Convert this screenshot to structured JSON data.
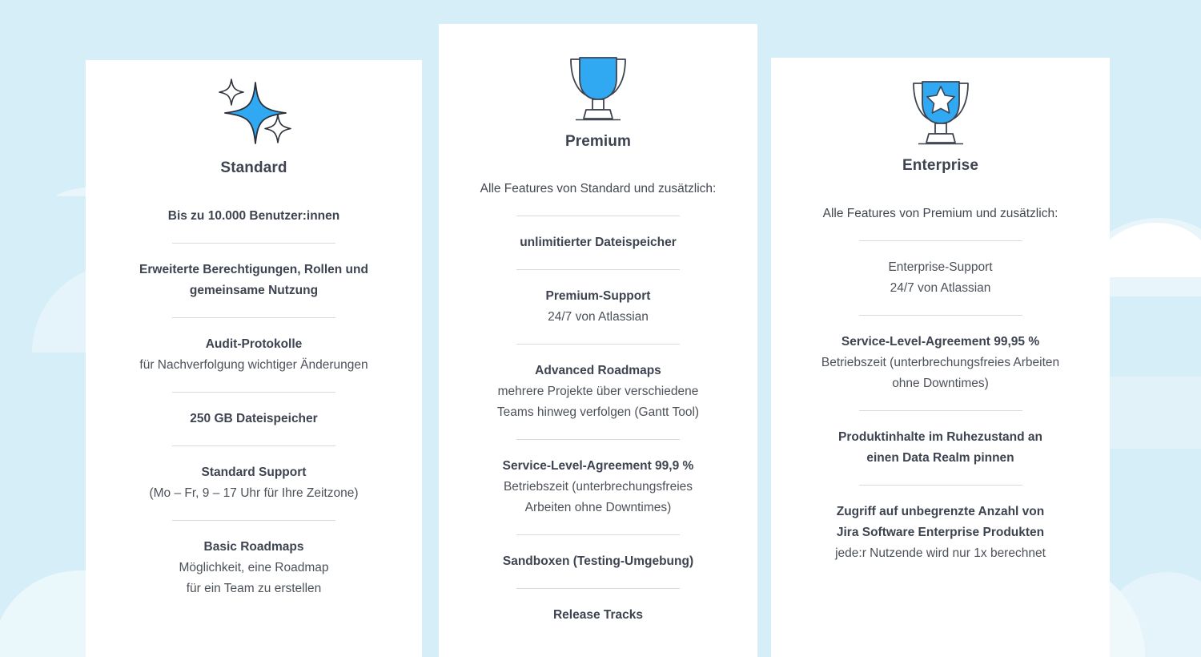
{
  "theme": {
    "background": "#d6eef7",
    "cloud_white": "#ffffff",
    "cloud_light": "#e8f6fb",
    "accent_blue": "#30a9f2",
    "text_dark": "#3d4450",
    "text_body": "#4c5158",
    "divider": "#d8dade",
    "card_bg": "#ffffff"
  },
  "plans": [
    {
      "id": "standard",
      "name": "Standard",
      "icon": "sparkle-icon",
      "intro": "Bis zu 10.000 Benutzer:innen",
      "features": [
        {
          "title": "Erweiterte Berechtigungen, Rollen und gemeinsame Nutzung",
          "sub": ""
        },
        {
          "title": "Audit-Protokolle",
          "sub": "für Nachverfolgung wichtiger Änderungen"
        },
        {
          "title": "250 GB Dateispeicher",
          "sub": ""
        },
        {
          "title": "Standard Support",
          "sub": "(Mo – Fr, 9 – 17 Uhr für Ihre Zeitzone)"
        },
        {
          "title": "Basic Roadmaps",
          "sub": "Möglichkeit, eine Roadmap\nfür ein Team zu erstellen"
        }
      ]
    },
    {
      "id": "premium",
      "name": "Premium",
      "icon": "trophy-icon",
      "intro": "Alle Features von Standard und zusätzlich:",
      "features": [
        {
          "title": "unlimitierter Dateispeicher",
          "sub": ""
        },
        {
          "title": "Premium-Support",
          "sub": "24/7 von Atlassian"
        },
        {
          "title": "Advanced Roadmaps",
          "sub": "mehrere Projekte über verschiedene\nTeams hinweg verfolgen (Gantt Tool)"
        },
        {
          "title": "Service-Level-Agreement 99,9 %",
          "sub": "Betriebszeit (unterbrechungsfreies\nArbeiten ohne Downtimes)"
        },
        {
          "title": "Sandboxen (Testing-Umgebung)",
          "sub": ""
        },
        {
          "title": "Release Tracks",
          "sub": ""
        }
      ]
    },
    {
      "id": "enterprise",
      "name": "Enterprise",
      "icon": "trophy-star-icon",
      "intro": "Alle Features von Premium und zusätzlich:",
      "features": [
        {
          "title": "",
          "sub": "Enterprise-Support\n24/7 von Atlassian"
        },
        {
          "title": "Service-Level-Agreement 99,95 %",
          "sub": "Betriebszeit (unterbrechungsfreies Arbeiten\nohne Downtimes)"
        },
        {
          "title": "Produktinhalte im Ruhezustand an\neinen Data Realm pinnen",
          "sub": ""
        },
        {
          "title": "Zugriff auf unbegrenzte Anzahl von\nJira Software Enterprise Produkten",
          "sub": "jede:r Nutzende wird nur 1x berechnet"
        }
      ]
    }
  ]
}
